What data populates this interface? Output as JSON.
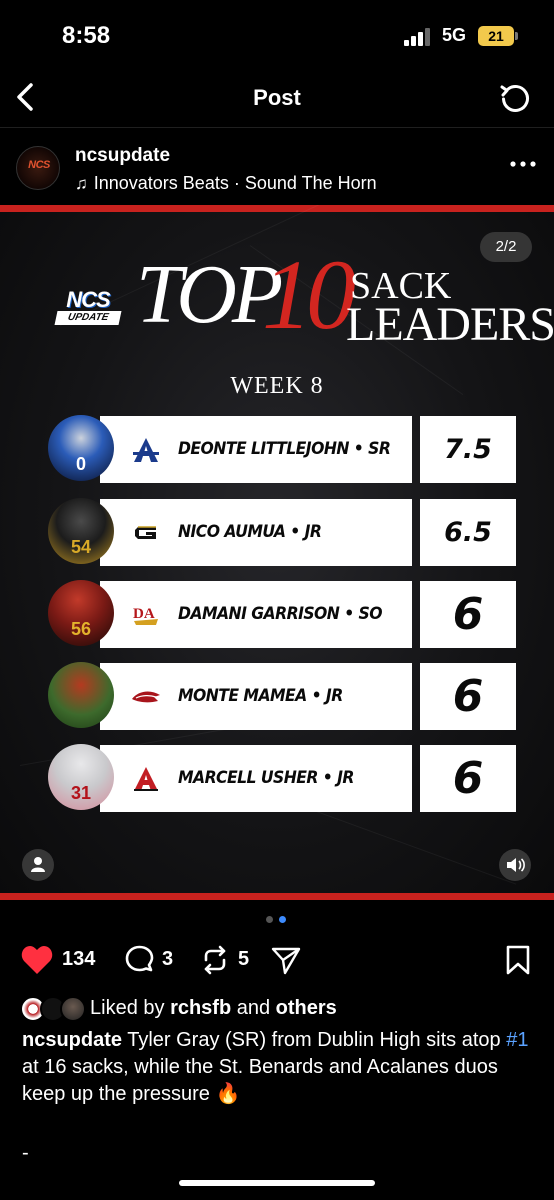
{
  "status_bar": {
    "time": "8:58",
    "network": "5G",
    "battery": "21"
  },
  "nav": {
    "title": "Post"
  },
  "post": {
    "username": "ncsupdate",
    "avatar_text": "NCS",
    "audio_artist": "Innovators Beats",
    "audio_separator": " · ",
    "audio_track": "Sound The Horn"
  },
  "graphic": {
    "page_indicator": "2/2",
    "logo_main": "NCS",
    "logo_sub": "UPDATE",
    "title_top": "TOP",
    "title_number": "10",
    "title_line1": "SACK",
    "title_line2": "LEADERS",
    "week": "WEEK 8",
    "accent_color": "#d32620",
    "leaders": [
      {
        "name": "DEONTE LITTLEJOHN • SR",
        "sacks": "7.5",
        "school_icon": "school-logo-a-blue",
        "jersey": "0"
      },
      {
        "name": "NICO AUMUA • JR",
        "sacks": "6.5",
        "school_icon": "school-logo-g-gold",
        "jersey": "54"
      },
      {
        "name": "DAMANI GARRISON • SO",
        "sacks": "6",
        "school_icon": "school-logo-da",
        "jersey": "56"
      },
      {
        "name": "MONTE MAMEA  • JR",
        "sacks": "6",
        "school_icon": "school-logo-hawk",
        "jersey": ""
      },
      {
        "name": "MARCELL USHER • JR",
        "sacks": "6",
        "school_icon": "school-logo-a-red",
        "jersey": "31"
      }
    ]
  },
  "carousel": {
    "total": 2,
    "active": 2
  },
  "actions": {
    "likes": "134",
    "comments": "3",
    "reposts": "5"
  },
  "liked_by": {
    "prefix": "Liked by ",
    "user": "rchsfb",
    "middle": " and ",
    "others": "others"
  },
  "caption": {
    "username": "ncsupdate",
    "text_before": " Tyler Gray (SR) from Dublin High sits atop ",
    "hashtag": "#1",
    "text_after": " at 16 sacks, while the St. Benards and Acalanes duos keep up the pressure 🔥"
  },
  "more_text": "-"
}
